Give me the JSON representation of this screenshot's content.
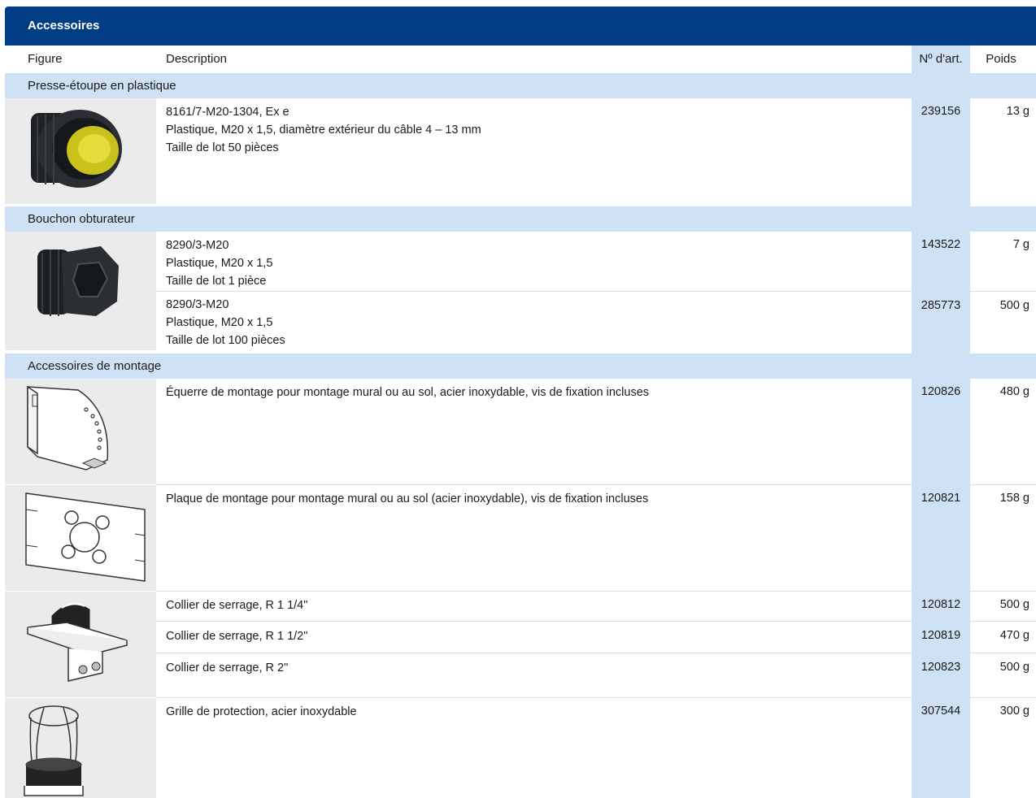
{
  "header": {
    "title": "Accessoires"
  },
  "columns": {
    "figure": "Figure",
    "description": "Description",
    "art": "Nº d'art.",
    "weight": "Poids"
  },
  "sections": [
    {
      "title": "Presse-étoupe en plastique"
    },
    {
      "title": "Bouchon obturateur"
    },
    {
      "title": "Accessoires de montage"
    }
  ],
  "rows": [
    {
      "desc1": "8161/7-M20-1304, Ex e",
      "desc2": "Plastique, M20 x 1,5, diamètre extérieur du câble 4 – 13 mm",
      "desc3": "Taille de lot 50 pièces",
      "art": "239156",
      "weight": "13 g",
      "icon": "cable-gland-icon"
    },
    {
      "desc1": "8290/3-M20",
      "desc2": "Plastique, M20 x 1,5",
      "desc3": "Taille de lot 1 pièce",
      "art": "143522",
      "weight": "7 g",
      "icon": "blanking-plug-icon"
    },
    {
      "desc1": "8290/3-M20",
      "desc2": "Plastique, M20 x 1,5",
      "desc3": "Taille de lot 100 pièces",
      "art": "285773",
      "weight": "500 g"
    },
    {
      "desc1": "Équerre de montage pour montage mural ou au sol, acier inoxydable, vis de fixation incluses",
      "art": "120826",
      "weight": "480 g",
      "icon": "mounting-bracket-icon"
    },
    {
      "desc1": "Plaque de montage pour montage mural ou au sol (acier inoxydable), vis de fixation incluses",
      "art": "120821",
      "weight": "158 g",
      "icon": "mounting-plate-icon"
    },
    {
      "desc1": "Collier de serrage, R 1 1/4\"",
      "art": "120812",
      "weight": "500 g",
      "icon": "pipe-clamp-icon"
    },
    {
      "desc1": "Collier de serrage, R 1 1/2\"",
      "art": "120819",
      "weight": "470 g"
    },
    {
      "desc1": "Collier de serrage, R 2\"",
      "art": "120823",
      "weight": "500 g"
    },
    {
      "desc1": "Grille de protection, acier inoxydable",
      "art": "307544",
      "weight": "300 g",
      "icon": "protection-grille-icon"
    }
  ]
}
